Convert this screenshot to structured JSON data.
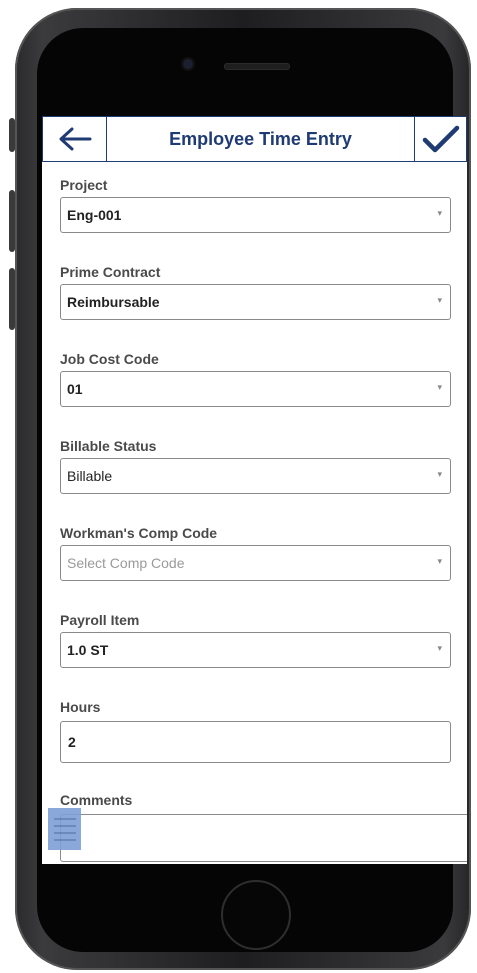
{
  "header": {
    "title": "Employee Time Entry",
    "back_icon": "arrow-left-icon",
    "save_icon": "checkmark-icon"
  },
  "fields": {
    "project": {
      "label": "Project",
      "value": "Eng-001"
    },
    "prime_contract": {
      "label": "Prime Contract",
      "value": "Reimbursable"
    },
    "job_cost_code": {
      "label": "Job Cost Code",
      "value": "01"
    },
    "billable_status": {
      "label": "Billable Status",
      "value": "Billable"
    },
    "workmans_comp_code": {
      "label": "Workman's Comp Code",
      "placeholder": "Select Comp Code"
    },
    "payroll_item": {
      "label": "Payroll Item",
      "value": "1.0 ST"
    },
    "hours": {
      "label": "Hours",
      "value": "2"
    },
    "comments": {
      "label": "Comments",
      "value": ""
    }
  },
  "dropdown_arrow": "▾",
  "colors": {
    "accent": "#1f3b73",
    "menu_button": "#7ea0d6"
  }
}
